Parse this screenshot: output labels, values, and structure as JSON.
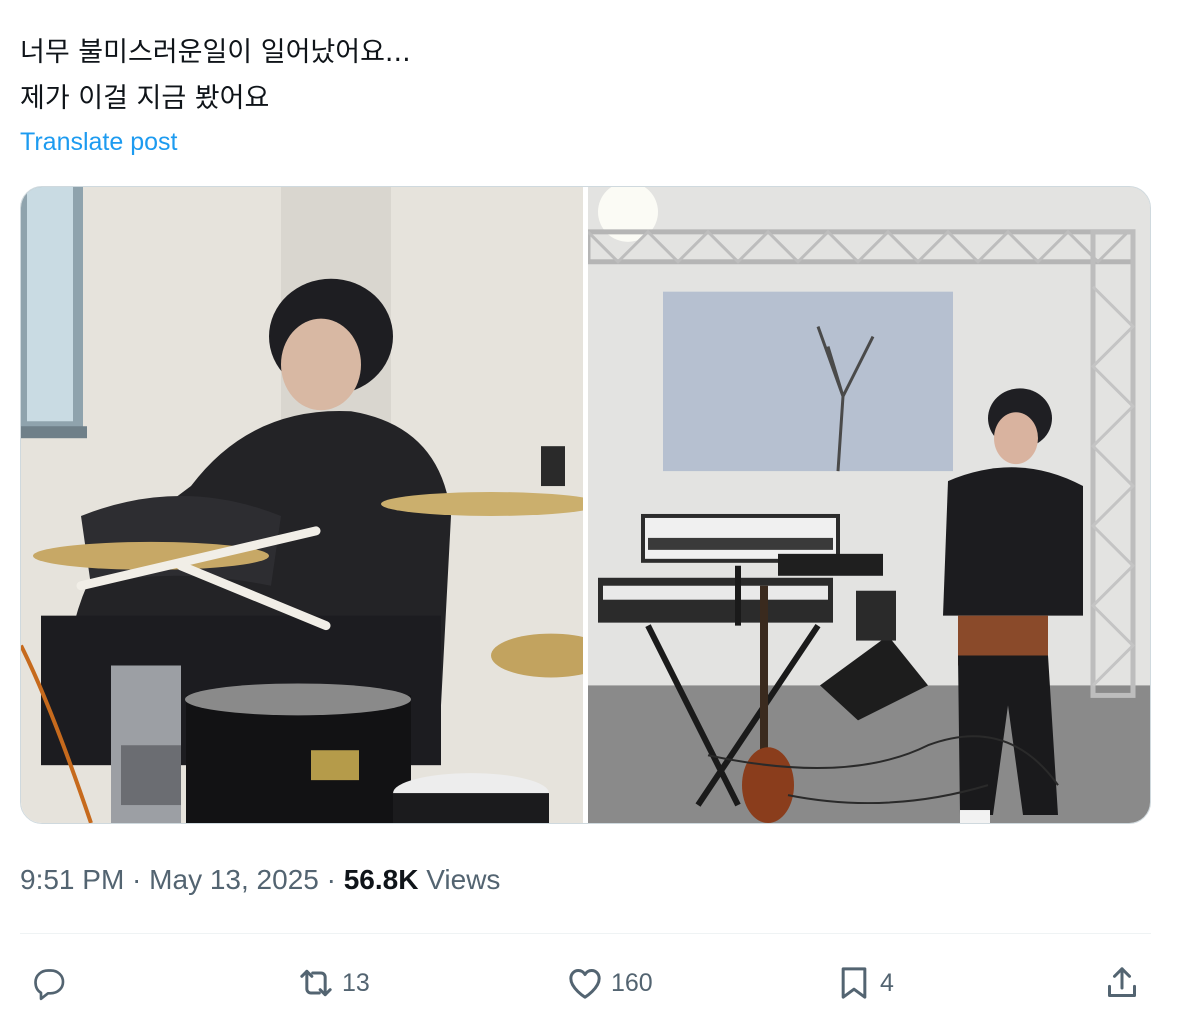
{
  "tweet": {
    "lines": [
      "너무 불미스러운일이 일어났어요...",
      "제가 이걸 지금 봤어요"
    ],
    "translate_label": "Translate post"
  },
  "media": [
    {
      "icon": "photo-drummer"
    },
    {
      "icon": "photo-stage"
    }
  ],
  "meta": {
    "time": "9:51 PM",
    "separator": " · ",
    "date": "May 13, 2025",
    "views_count": "56.8K",
    "views_label": "Views"
  },
  "actions": {
    "reply": {
      "icon": "reply-icon",
      "count": ""
    },
    "repost": {
      "icon": "repost-icon",
      "count": "13"
    },
    "like": {
      "icon": "heart-icon",
      "count": "160"
    },
    "bookmark": {
      "icon": "bookmark-icon",
      "count": "4"
    },
    "share": {
      "icon": "share-icon",
      "count": ""
    }
  },
  "colors": {
    "text": "#0f1419",
    "secondary": "#536471",
    "link": "#1d9bf0",
    "border": "#cfd9de"
  }
}
